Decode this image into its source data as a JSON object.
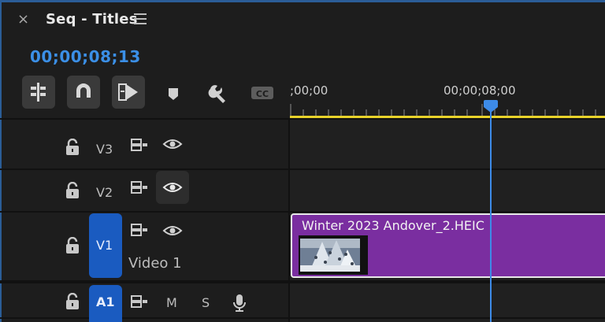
{
  "panel": {
    "close_glyph": "×",
    "title": "Seq - Titles",
    "menu_icon": "hamburger-icon",
    "timecode": "00;00;08;13"
  },
  "toolbar": {
    "buttons": [
      {
        "name": "insert-overwrite-nest-icon",
        "active": true
      },
      {
        "name": "snap-magnet-icon",
        "active": true
      },
      {
        "name": "linked-selection-icon",
        "active": true
      },
      {
        "name": "add-marker-icon",
        "active": false
      },
      {
        "name": "timeline-settings-wrench-icon",
        "active": false
      },
      {
        "name": "captions-cc-icon",
        "active": false,
        "label": "CC"
      }
    ]
  },
  "ruler": {
    "start_label": ";00;00",
    "mid_label": "00;00;08;00",
    "work_area_color": "#e8d22a",
    "playhead_color": "#3d8be8"
  },
  "tracks": {
    "v3": {
      "label": "V3"
    },
    "v2": {
      "label": "V2"
    },
    "v1": {
      "target_label": "V1",
      "name": "Video 1"
    },
    "a1": {
      "target_label": "A1",
      "mute": "M",
      "solo": "S"
    }
  },
  "clip": {
    "name": "Winter 2023 Andover_2.HEIC",
    "color": "#7a2ea0"
  },
  "colors": {
    "accent": "#3b8fe6",
    "track_target": "#1a5bc0",
    "background": "#1d1d1d"
  }
}
